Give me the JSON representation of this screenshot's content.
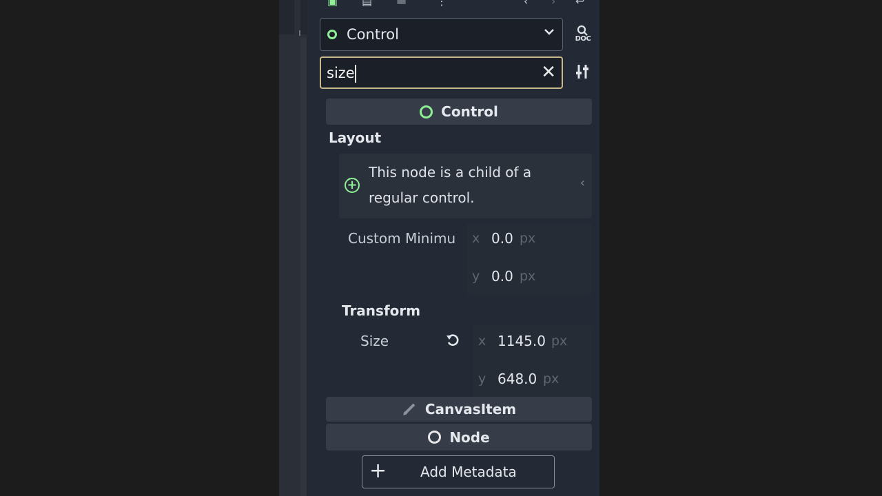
{
  "node_selector": {
    "label": "Control",
    "doc_label": "DOC"
  },
  "filter": {
    "value": "size"
  },
  "sections": {
    "control": "Control",
    "canvas_item": "CanvasItem",
    "node": "Node"
  },
  "layout": {
    "title": "Layout",
    "info_line1": "This node is a child of a",
    "info_line2": "regular control.",
    "custom_min": {
      "label": "Custom Minimu",
      "x_axis": "x",
      "x_value": "0.0",
      "x_unit": "px",
      "y_axis": "y",
      "y_value": "0.0",
      "y_unit": "px"
    }
  },
  "transform": {
    "title": "Transform",
    "size": {
      "label": "Size",
      "x_axis": "x",
      "x_value": "1145.0",
      "x_unit": "px",
      "y_axis": "y",
      "y_value": "648.0",
      "y_unit": "px"
    }
  },
  "add_metadata": "Add Metadata"
}
